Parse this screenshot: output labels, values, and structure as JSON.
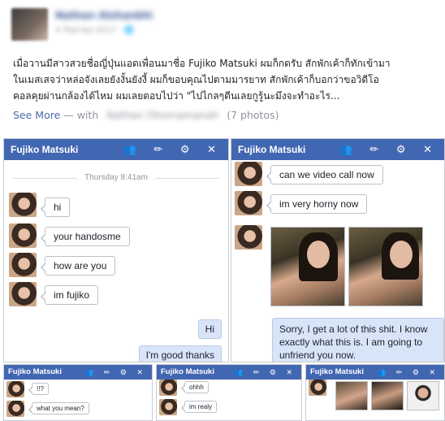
{
  "post": {
    "author": "Nathan Alshanbhi",
    "meta": "4 กันยายน 2017 · 🌐",
    "lines": [
      "เมื่อวานมีสาวสวยชื่อญี่ปุ่นแอดเพื่อนมาชื่อ Fujiko Matsuki ผมก็กดรับ สักพักเค้าก็ทักเข้ามา",
      "ในเมสเสจว่าหล่อจังเลยยังงั้นยังงี้ ผมก็ขอบคุณไปตามมารยาท สักพักเค้าก็บอกว่าขอวิดีโอ",
      "คอลคุยผ่านกล้องได้ไหม ผมเลยตอบไปว่า \"ไปไกลๆตีนเลยกูรู้นะมึงจะทำอะไร..."
    ],
    "see_more": "See More",
    "with_text": "— with",
    "tagged": "Nathan Ohomamanah",
    "photos": "(7 photos)"
  },
  "chat1": {
    "name": "Fujiko Matsuki",
    "icons": "👥 ✏ ⚙ ✕",
    "timestamp": "Thursday 8:41am",
    "messages": [
      "hi",
      "your handosme",
      "how are you",
      "im fujiko"
    ],
    "mine": [
      "Hi",
      "I'm good thanks"
    ]
  },
  "chat2": {
    "name": "Fujiko Matsuki",
    "icons": "👥 ✏ ⚙ ✕",
    "messages": [
      "can we video call now",
      "im very horny now"
    ],
    "reply": "Sorry, I get a lot of this shit. I know exactly what this is. I am going to unfriend you now."
  },
  "chat3": {
    "name": "Fujiko Matsuki",
    "icons": "👥 ✏ ⚙ ✕",
    "messages": [
      "!!?",
      "what you mean?"
    ]
  },
  "chat4": {
    "name": "Fujiko Matsuki",
    "icons": "👥 ✏ ⚙ ✕",
    "messages": [
      "ohhh",
      "im realy"
    ]
  },
  "chat5": {
    "name": "Fujiko Matsuki",
    "icons": "👥 ✏ ⚙ ✕"
  }
}
